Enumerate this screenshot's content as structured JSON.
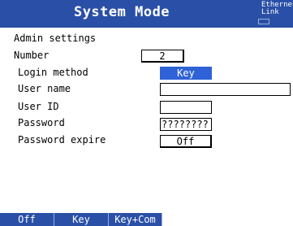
{
  "header": {
    "title": "System Mode",
    "status_line1": "Ethernet",
    "status_line2": "Link"
  },
  "section_title": "Admin settings",
  "form": {
    "number_label": "Number",
    "number_value": "2",
    "login_method_label": "Login method",
    "login_method_value": "Key",
    "user_name_label": "User name",
    "user_name_value": "",
    "user_id_label": "User ID",
    "user_id_value": "",
    "password_label": "Password",
    "password_value": "????????",
    "password_expire_label": "Password expire",
    "password_expire_value": "Off"
  },
  "softkeys": [
    "Off",
    "Key",
    "Key+Com"
  ],
  "colors": {
    "title_bar": "#2a4fa6",
    "selection": "#2f62d6",
    "background": "#ffffff"
  }
}
